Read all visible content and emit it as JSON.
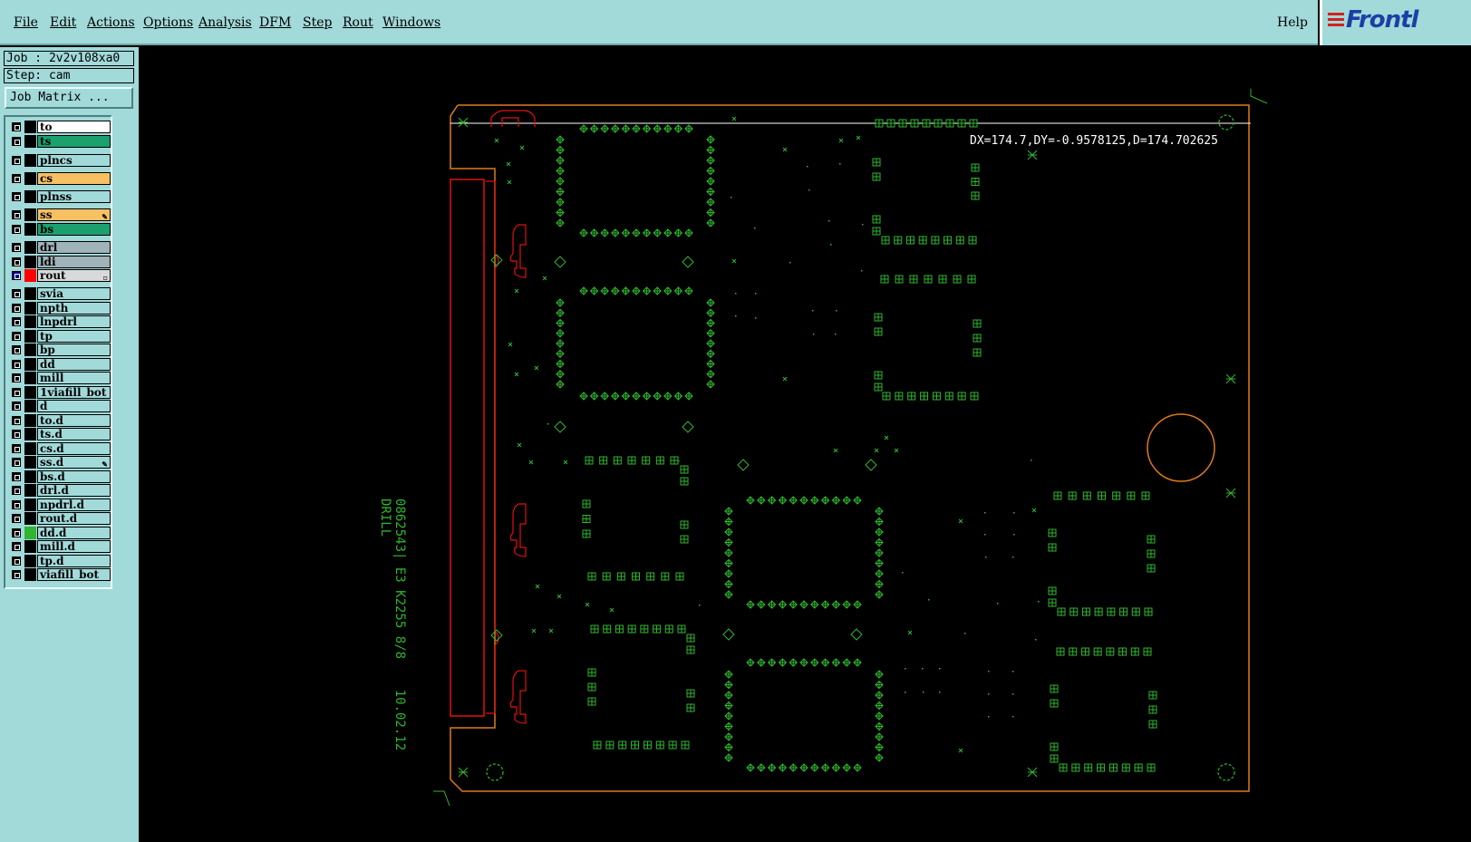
{
  "menu": {
    "items": [
      "File",
      "Edit",
      "Actions",
      "Options",
      "Analysis",
      "DFM",
      "Step",
      "Rout",
      "Windows"
    ],
    "help": "Help"
  },
  "logo": {
    "text": "Frontl"
  },
  "job": {
    "job_line": "Job : 2v2v108xa0",
    "step_line": "Step: cam",
    "matrix_button": "Job Matrix ..."
  },
  "layers": [
    {
      "name": "to",
      "color": "#ffffff"
    },
    {
      "name": "ts",
      "color": "#1ba06e"
    },
    {
      "name": "plncs",
      "color": "#a2d9d9"
    },
    {
      "name": "cs",
      "color": "#f7c063"
    },
    {
      "name": "plnss",
      "color": "#a2d9d9"
    },
    {
      "name": "ss",
      "color": "#f7c063"
    },
    {
      "name": "bs",
      "color": "#1ba06e"
    },
    {
      "name": "drl",
      "color": "#9fb3b9"
    },
    {
      "name": "ldi",
      "color": "#9fb3b9"
    },
    {
      "name": "rout",
      "color": "#d9d9d9"
    },
    {
      "name": "svia",
      "color": "#a2d9d9"
    },
    {
      "name": "npth",
      "color": "#a2d9d9"
    },
    {
      "name": "lnpdrl",
      "color": "#a2d9d9"
    },
    {
      "name": "tp",
      "color": "#a2d9d9"
    },
    {
      "name": "bp",
      "color": "#a2d9d9"
    },
    {
      "name": "dd",
      "color": "#a2d9d9"
    },
    {
      "name": "mill",
      "color": "#a2d9d9"
    },
    {
      "name": "1viafill_bot",
      "color": "#a2d9d9"
    },
    {
      "name": "d",
      "color": "#a2d9d9"
    },
    {
      "name": "to.d",
      "color": "#a2d9d9"
    },
    {
      "name": "ts.d",
      "color": "#a2d9d9"
    },
    {
      "name": "cs.d",
      "color": "#a2d9d9"
    },
    {
      "name": "ss.d",
      "color": "#a2d9d9"
    },
    {
      "name": "bs.d",
      "color": "#a2d9d9"
    },
    {
      "name": "drl.d",
      "color": "#a2d9d9"
    },
    {
      "name": "npdrl.d",
      "color": "#a2d9d9"
    },
    {
      "name": "rout.d",
      "color": "#a2d9d9"
    },
    {
      "name": "dd.d",
      "color": "#a2d9d9"
    },
    {
      "name": "mill.d",
      "color": "#a2d9d9"
    },
    {
      "name": "tp.d",
      "color": "#a2d9d9"
    },
    {
      "name": "viafill_bot",
      "color": "#a2d9d9"
    }
  ],
  "canvas": {
    "measurement": "DX=174.7,DY=-0.9578125,D=174.702625",
    "drill_label": "0862543| E3 K2255 8/8    10.02.12\nDRILL",
    "colors": {
      "outline": "#e07a1a",
      "features": "#2fb52f",
      "rout": "#e01010"
    }
  }
}
